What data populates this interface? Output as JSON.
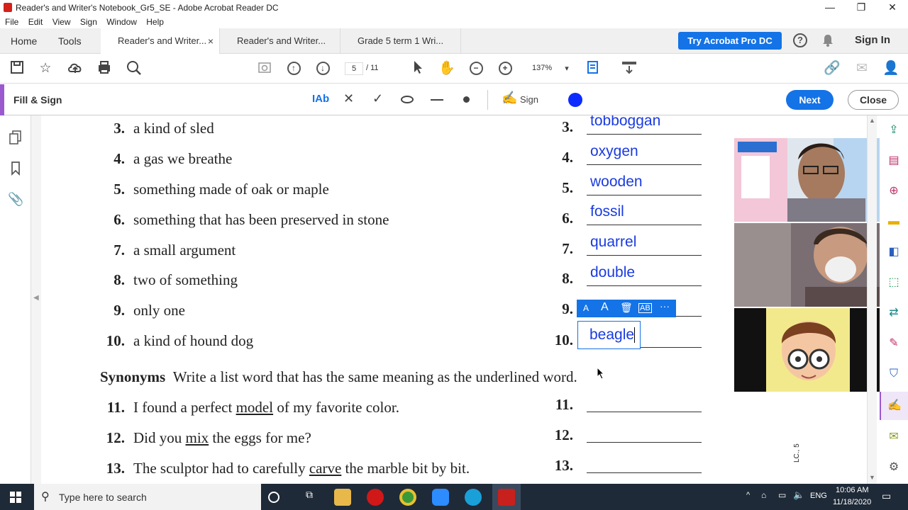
{
  "window": {
    "title": "Reader's and Writer's Notebook_Gr5_SE - Adobe Acrobat Reader DC",
    "minimize": "—",
    "restore": "❐",
    "close": "✕"
  },
  "menu": [
    "File",
    "Edit",
    "View",
    "Sign",
    "Window",
    "Help"
  ],
  "tabs": {
    "home": "Home",
    "tools": "Tools",
    "docs": [
      {
        "label": "Reader's and Writer...",
        "close": "×"
      },
      {
        "label": "Reader's and Writer..."
      },
      {
        "label": "Grade 5 term 1 Wri..."
      }
    ],
    "try_pro": "Try Acrobat Pro DC",
    "help": "?",
    "sign_in": "Sign In"
  },
  "toolbar": {
    "page_current": "5",
    "page_total": "/ 11",
    "zoom": "137%"
  },
  "fill_sign": {
    "title": "Fill & Sign",
    "text_tool": "IAb",
    "sign_label": "Sign",
    "color": "#0d2bff",
    "next": "Next",
    "close": "Close"
  },
  "questions": [
    {
      "num": "3.",
      "text": "a kind of sled"
    },
    {
      "num": "4.",
      "text": "a gas we breathe"
    },
    {
      "num": "5.",
      "text": "something made of oak or maple"
    },
    {
      "num": "6.",
      "text": "something that has been preserved in stone"
    },
    {
      "num": "7.",
      "text": "a small argument"
    },
    {
      "num": "8.",
      "text": "two of something"
    },
    {
      "num": "9.",
      "text": "only one"
    },
    {
      "num": "10.",
      "text": "a kind of hound dog"
    }
  ],
  "answers": [
    {
      "num": "3.",
      "value": "tobboggan"
    },
    {
      "num": "4.",
      "value": "oxygen"
    },
    {
      "num": "5.",
      "value": "wooden"
    },
    {
      "num": "6.",
      "value": "fossil"
    },
    {
      "num": "7.",
      "value": "quarrel"
    },
    {
      "num": "8.",
      "value": "double"
    },
    {
      "num": "9.",
      "value": ""
    },
    {
      "num": "10.",
      "value": "beagle"
    }
  ],
  "synonyms": {
    "heading": "Synonyms",
    "instruction": "Write a list word that has the same meaning as the underlined word."
  },
  "synonym_items": [
    {
      "num": "11.",
      "before": "I found a perfect ",
      "word": "model",
      "after": " of my favorite color."
    },
    {
      "num": "12.",
      "before": "Did you ",
      "word": "mix",
      "after": " the eggs for me?"
    },
    {
      "num": "13.",
      "before": "The sculptor had to carefully ",
      "word": "carve",
      "after": " the marble bit by bit."
    }
  ],
  "synonym_answers": [
    "11.",
    "12.",
    "13."
  ],
  "edit_toolbar": {
    "small_a": "A",
    "large_a": "A",
    "delete": "🗑",
    "field": "AB",
    "more": "···"
  },
  "margin_note": "LC., 5",
  "taskbar": {
    "search_placeholder": "Type here to search",
    "language": "ENG",
    "time": "10:06 AM",
    "date": "11/18/2020"
  }
}
